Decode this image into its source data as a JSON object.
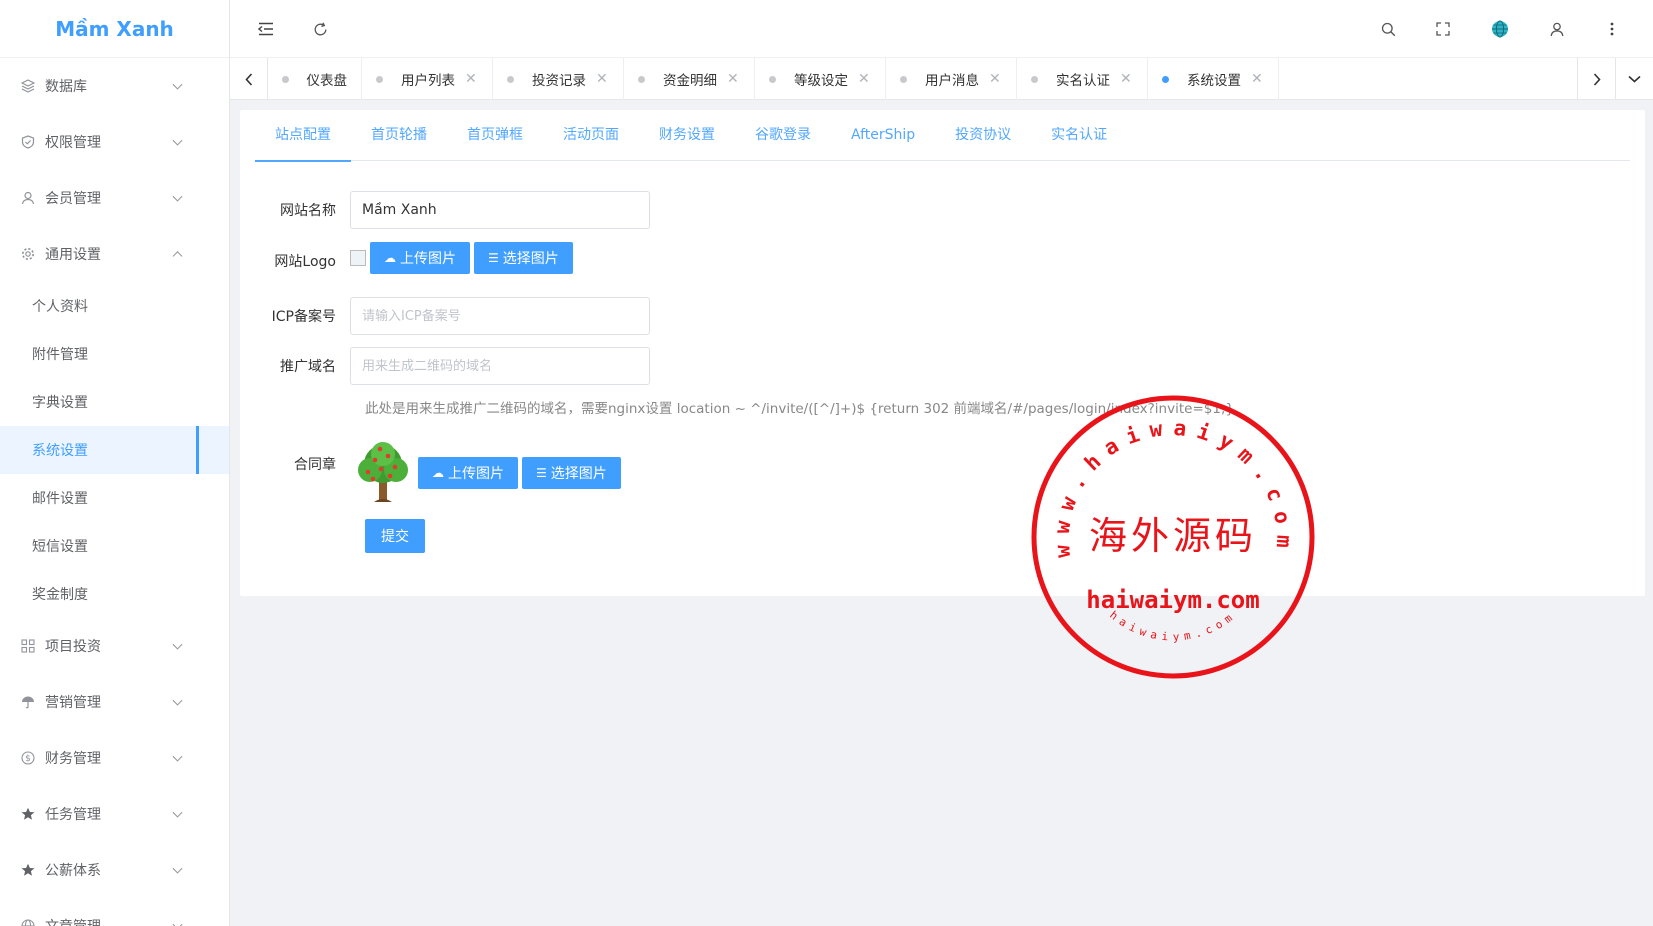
{
  "brand": {
    "name": "Mầm Xanh",
    "color": "#409eff"
  },
  "sidebar": {
    "items": [
      {
        "label": "数据库",
        "icon": "database-icon",
        "expanded": false
      },
      {
        "label": "权限管理",
        "icon": "shield-icon",
        "expanded": false
      },
      {
        "label": "会员管理",
        "icon": "user-icon",
        "expanded": false
      },
      {
        "label": "通用设置",
        "icon": "gear-icon",
        "expanded": true,
        "children": [
          "个人资料",
          "附件管理",
          "字典设置",
          "系统设置",
          "邮件设置",
          "短信设置",
          "奖金制度"
        ],
        "active_child": "系统设置"
      },
      {
        "label": "项目投资",
        "icon": "apps-icon",
        "expanded": false
      },
      {
        "label": "营销管理",
        "icon": "umbrella-icon",
        "expanded": false
      },
      {
        "label": "财务管理",
        "icon": "dollar-icon",
        "expanded": false
      },
      {
        "label": "任务管理",
        "icon": "star-icon",
        "expanded": false
      },
      {
        "label": "公薪体系",
        "icon": "star-icon",
        "expanded": false
      },
      {
        "label": "文章管理",
        "icon": "globe-icon",
        "expanded": false
      }
    ]
  },
  "header": {
    "icons": [
      "menu-fold-icon",
      "refresh-icon",
      "search-icon",
      "fullscreen-icon",
      "globe-icon",
      "user-icon",
      "more-icon"
    ]
  },
  "tabs": [
    {
      "label": "仪表盘",
      "closable": false,
      "active": false
    },
    {
      "label": "用户列表",
      "closable": true,
      "active": false
    },
    {
      "label": "投资记录",
      "closable": true,
      "active": false
    },
    {
      "label": "资金明细",
      "closable": true,
      "active": false
    },
    {
      "label": "等级设定",
      "closable": true,
      "active": false
    },
    {
      "label": "用户消息",
      "closable": true,
      "active": false
    },
    {
      "label": "实名认证",
      "closable": true,
      "active": false
    },
    {
      "label": "系统设置",
      "closable": true,
      "active": true
    }
  ],
  "subtabs": [
    "站点配置",
    "首页轮播",
    "首页弹框",
    "活动页面",
    "财务设置",
    "谷歌登录",
    "AfterShip",
    "投资协议",
    "实名认证"
  ],
  "form": {
    "site_name_label": "网站名称",
    "site_name_value": "Mầm Xanh",
    "logo_label": "网站Logo",
    "upload_label": "上传图片",
    "select_label": "选择图片",
    "icp_label": "ICP备案号",
    "icp_placeholder": "请输入ICP备案号",
    "domain_label": "推广域名",
    "domain_placeholder": "用来生成二维码的域名",
    "domain_hint": "此处是用来生成推广二维码的域名，需要nginx设置 location ~ ^/invite/([^/]+)$ {return 302 前端域名/#/pages/login/index?invite=$1;}",
    "contract_label": "合同章",
    "submit_label": "提交"
  },
  "watermark": {
    "center_text": "海外源码",
    "domain_text": "haiwaiym.com",
    "ring_text": "www.haiwaiym.com",
    "small_ring_text": "haiwaiym.com",
    "color": "#e8141a"
  }
}
